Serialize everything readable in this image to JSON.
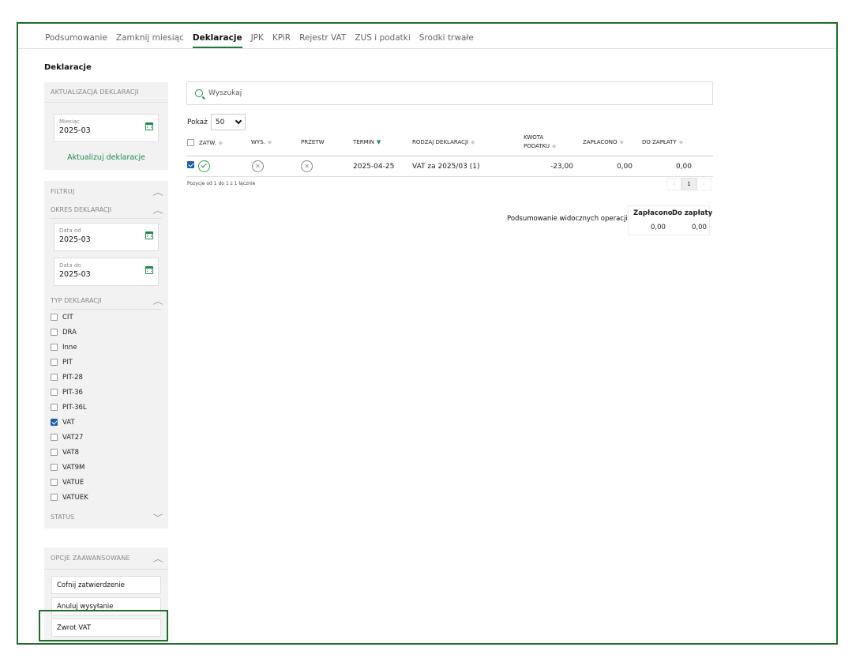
{
  "nav": {
    "tabs": [
      {
        "label": "Podsumowanie",
        "active": false
      },
      {
        "label": "Zamknij miesiąc",
        "active": false
      },
      {
        "label": "Deklaracje",
        "active": true
      },
      {
        "label": "JPK",
        "active": false
      },
      {
        "label": "KPiR",
        "active": false
      },
      {
        "label": "Rejestr VAT",
        "active": false
      },
      {
        "label": "ZUS i podatki",
        "active": false
      },
      {
        "label": "Środki trwałe",
        "active": false
      }
    ]
  },
  "page_title": "Deklaracje",
  "sidebar": {
    "update": {
      "header": "AKTUALIZACJA DEKLARACJI",
      "month_label": "Miesiąc",
      "month_value": "2025-03",
      "button": "Aktualizuj deklaracje"
    },
    "filter_header": "FILTRUJ",
    "period": {
      "header": "OKRES DEKLARACJI",
      "from_label": "Data od",
      "from_value": "2025-03",
      "to_label": "Data do",
      "to_value": "2025-03"
    },
    "types": {
      "header": "TYP DEKLARACJI",
      "items": [
        {
          "label": "CIT",
          "checked": false
        },
        {
          "label": "DRA",
          "checked": false
        },
        {
          "label": "Inne",
          "checked": false
        },
        {
          "label": "PIT",
          "checked": false
        },
        {
          "label": "PIT-28",
          "checked": false
        },
        {
          "label": "PIT-36",
          "checked": false
        },
        {
          "label": "PIT-36L",
          "checked": false
        },
        {
          "label": "VAT",
          "checked": true
        },
        {
          "label": "VAT27",
          "checked": false
        },
        {
          "label": "VAT8",
          "checked": false
        },
        {
          "label": "VAT9M",
          "checked": false
        },
        {
          "label": "VATUE",
          "checked": false
        },
        {
          "label": "VATUEK",
          "checked": false
        }
      ]
    },
    "status_header": "STATUS",
    "advanced": {
      "header": "OPCJE ZAAWANSOWANE",
      "buttons": [
        "Cofnij zatwierdzenie",
        "Anuluj wysyłanie",
        "Zwrot VAT"
      ]
    }
  },
  "search": {
    "placeholder": "Wyszukaj"
  },
  "show": {
    "label": "Pokaż",
    "value": "50"
  },
  "table": {
    "columns": {
      "approved": "ZATW.",
      "sent": "WYS.",
      "transfer": "PRZETW",
      "deadline": "TERMIN",
      "type": "RODZAJ DEKLARACJI",
      "tax_amount_1": "KWOTA",
      "tax_amount_2": "PODATKU",
      "paid": "ZAPŁACONO",
      "to_pay": "DO ZAPŁATY"
    },
    "rows": [
      {
        "checked": true,
        "approved": true,
        "sent": false,
        "transfer": false,
        "deadline": "2025-04-25",
        "type": "VAT za 2025/03 (1)",
        "tax_amount": "-23,00",
        "paid": "0,00",
        "to_pay": "0,00"
      }
    ],
    "info": "Pozycje od 1 do 1 z 1 łącznie",
    "pager": {
      "prev": "‹",
      "current": "1",
      "next": "›"
    }
  },
  "summary": {
    "label": "Podsumowanie widocznych operacji",
    "paid_header": "Zapłacono",
    "to_pay_header": "Do zapłaty",
    "paid_value": "0,00",
    "to_pay_value": "0,00"
  },
  "colors": {
    "accent": "#1f8a4c",
    "frame": "#1f6b2c",
    "checkbox": "#1f5fa8"
  }
}
